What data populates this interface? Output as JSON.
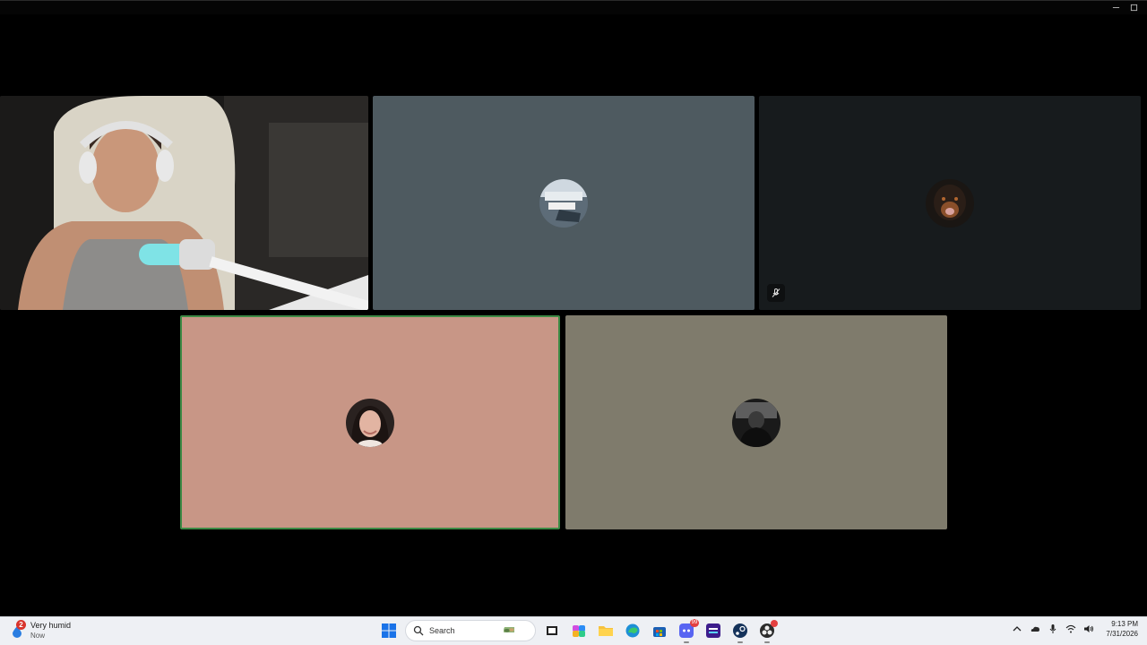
{
  "window": {
    "controls": [
      {
        "name": "minimize-button",
        "icon": "minimize-icon"
      },
      {
        "name": "maximize-button",
        "icon": "maximize-icon"
      }
    ]
  },
  "call": {
    "tiles": [
      {
        "id": "tile-1",
        "kind": "video",
        "background": "#151515"
      },
      {
        "id": "tile-2",
        "kind": "avatar",
        "background": "#4e5a60",
        "avatar_icon": "boat-harbor-avatar"
      },
      {
        "id": "tile-3",
        "kind": "avatar",
        "background": "#171b1d",
        "avatar_icon": "rottweiler-avatar",
        "muted": true,
        "mute_icon": "microphone-off-icon"
      },
      {
        "id": "tile-4",
        "kind": "avatar",
        "background": "#c89686",
        "avatar_icon": "person-selfie-avatar",
        "speaking": true,
        "speaking_color": "#3d8a45"
      },
      {
        "id": "tile-5",
        "kind": "avatar",
        "background": "#7f7b6c",
        "avatar_icon": "dark-photo-avatar"
      }
    ]
  },
  "taskbar": {
    "weather": {
      "title": "Very humid",
      "subtitle": "Now",
      "badge": "2"
    },
    "search": {
      "label": "Search"
    },
    "apps": [
      {
        "name": "start",
        "icon": "windows-start-icon"
      },
      {
        "name": "task-view",
        "icon": "task-view-icon"
      },
      {
        "name": "copilot",
        "icon": "copilot-icon"
      },
      {
        "name": "file-explorer",
        "icon": "folder-icon"
      },
      {
        "name": "edge",
        "icon": "edge-browser-icon"
      },
      {
        "name": "store",
        "icon": "store-icon"
      },
      {
        "name": "discord",
        "icon": "discord-icon",
        "badge": "99"
      },
      {
        "name": "amazon-music",
        "icon": "amazon-music-icon"
      },
      {
        "name": "steam",
        "icon": "steam-icon"
      },
      {
        "name": "app-with-alert",
        "icon": "obs-icon"
      }
    ],
    "tray": [
      "chevron-up-icon",
      "onedrive-icon",
      "microphone-icon",
      "wifi-icon",
      "volume-icon"
    ],
    "clock": {
      "time": "9:13 PM",
      "date": "7/31/2026"
    }
  },
  "colors": {
    "taskbar_bg": "#eef0f4",
    "speaking_border": "#3d8a45",
    "notification_red": "#e34040"
  }
}
